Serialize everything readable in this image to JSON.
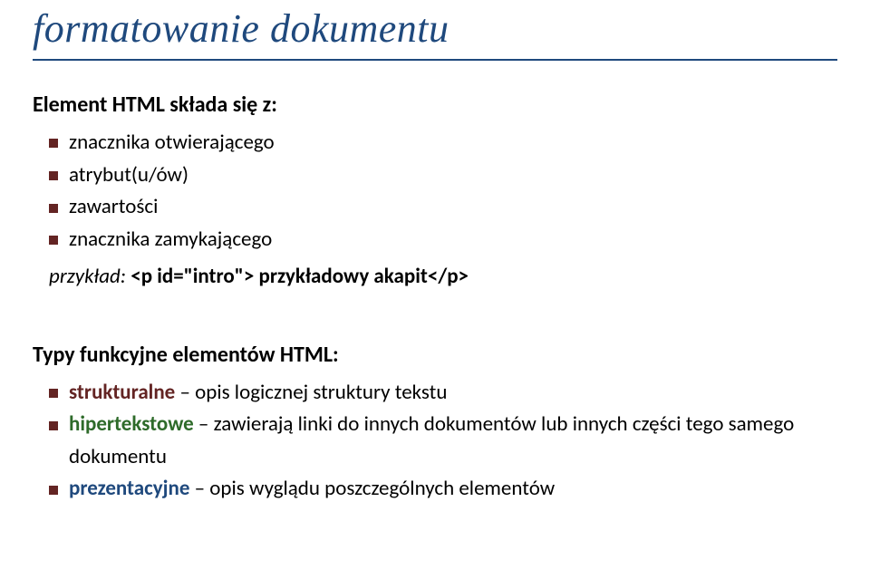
{
  "title": "formatowanie dokumentu",
  "section1": {
    "intro": "Element HTML składa się z:",
    "items": [
      "znacznika otwierającego",
      "atrybut(u/ów)",
      "zawartości",
      "znacznika zamykającego"
    ],
    "example_lead": "przykład: ",
    "example_code": "<p id=\"intro\"> przykładowy akapit</p>"
  },
  "section2": {
    "heading": "Typy funkcyjne elementów HTML:",
    "items": [
      {
        "term": "strukturalne",
        "rest": " – opis logicznej struktury tekstu",
        "cls": "term-strukturalne"
      },
      {
        "term": "hipertekstowe",
        "rest": " – zawierają linki do innych dokumentów lub innych części tego samego dokumentu",
        "cls": "term-hipertekstowe"
      },
      {
        "term": "prezentacyjne",
        "rest": " – opis wyglądu poszczególnych elementów",
        "cls": "term-prezentacyjne"
      }
    ]
  }
}
